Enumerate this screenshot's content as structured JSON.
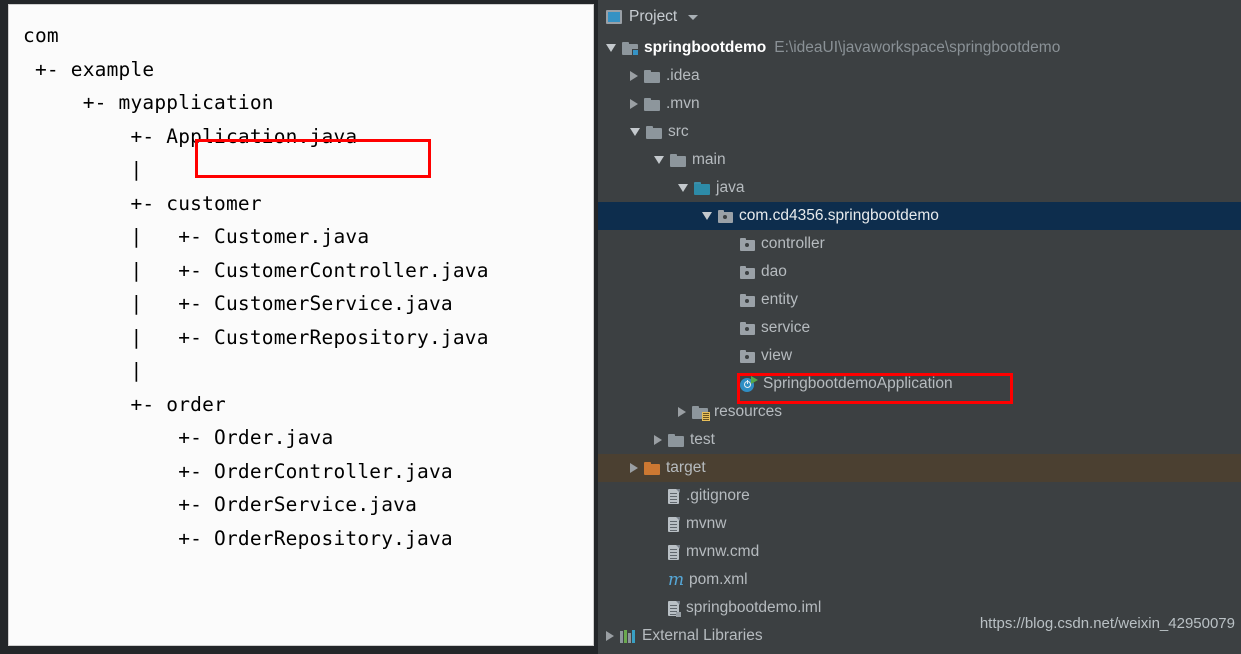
{
  "ascii_diagram": {
    "lines": [
      "com",
      " +- example",
      "     +- myapplication",
      "         +- Application.java",
      "         |",
      "         +- customer",
      "         |   +- Customer.java",
      "         |   +- CustomerController.java",
      "         |   +- CustomerService.java",
      "         |   +- CustomerRepository.java",
      "         |",
      "         +- order",
      "             +- Order.java",
      "             +- OrderController.java",
      "             +- OrderService.java",
      "             +- OrderRepository.java"
    ],
    "highlighted_entry": "Application.java"
  },
  "ide": {
    "toolbar": {
      "title": "Project",
      "project_icon": "project-view-icon",
      "dropdown_icon": "chevron-down-icon"
    },
    "highlighted_entry": "SpringbootdemoApplication",
    "watermark": "https://blog.csdn.net/weixin_42950079",
    "colors": {
      "panel_background": "#3c4042",
      "selection": "#0d2d4d",
      "excluded_row": "#4b4031",
      "highlight_box": "#ff0000",
      "source_folder": "#2d8ba8",
      "target_folder": "#cc7832"
    },
    "tree": [
      {
        "label": "springbootdemo",
        "path": "E:\\ideaUI\\javaworkspace\\springbootdemo",
        "indent": 0,
        "arrow": "down",
        "icon": "project-folder-icon",
        "style": "root"
      },
      {
        "label": ".idea",
        "path": "",
        "indent": 1,
        "arrow": "right",
        "icon": "folder-icon",
        "style": ""
      },
      {
        "label": ".mvn",
        "path": "",
        "indent": 1,
        "arrow": "right",
        "icon": "folder-icon",
        "style": ""
      },
      {
        "label": "src",
        "path": "",
        "indent": 1,
        "arrow": "down",
        "icon": "folder-icon",
        "style": ""
      },
      {
        "label": "main",
        "path": "",
        "indent": 2,
        "arrow": "down",
        "icon": "folder-icon",
        "style": ""
      },
      {
        "label": "java",
        "path": "",
        "indent": 3,
        "arrow": "down",
        "icon": "source-folder-icon",
        "style": ""
      },
      {
        "label": "com.cd4356.springbootdemo",
        "path": "",
        "indent": 4,
        "arrow": "down",
        "icon": "package-icon",
        "style": "selected"
      },
      {
        "label": "controller",
        "path": "",
        "indent": 5,
        "arrow": "none",
        "icon": "package-icon",
        "style": ""
      },
      {
        "label": "dao",
        "path": "",
        "indent": 5,
        "arrow": "none",
        "icon": "package-icon",
        "style": ""
      },
      {
        "label": "entity",
        "path": "",
        "indent": 5,
        "arrow": "none",
        "icon": "package-icon",
        "style": ""
      },
      {
        "label": "service",
        "path": "",
        "indent": 5,
        "arrow": "none",
        "icon": "package-icon",
        "style": ""
      },
      {
        "label": "view",
        "path": "",
        "indent": 5,
        "arrow": "none",
        "icon": "package-icon",
        "style": ""
      },
      {
        "label": "SpringbootdemoApplication",
        "path": "",
        "indent": 5,
        "arrow": "none",
        "icon": "spring-boot-run-icon",
        "style": ""
      },
      {
        "label": "resources",
        "path": "",
        "indent": 3,
        "arrow": "right",
        "icon": "resources-folder-icon",
        "style": ""
      },
      {
        "label": "test",
        "path": "",
        "indent": 2,
        "arrow": "right",
        "icon": "folder-icon",
        "style": ""
      },
      {
        "label": "target",
        "path": "",
        "indent": 1,
        "arrow": "right",
        "icon": "excluded-folder-icon",
        "style": "excluded"
      },
      {
        "label": ".gitignore",
        "path": "",
        "indent": 2,
        "arrow": "none",
        "icon": "file-icon",
        "style": ""
      },
      {
        "label": "mvnw",
        "path": "",
        "indent": 2,
        "arrow": "none",
        "icon": "file-icon",
        "style": ""
      },
      {
        "label": "mvnw.cmd",
        "path": "",
        "indent": 2,
        "arrow": "none",
        "icon": "file-icon",
        "style": ""
      },
      {
        "label": "pom.xml",
        "path": "",
        "indent": 2,
        "arrow": "none",
        "icon": "maven-icon",
        "style": ""
      },
      {
        "label": "springbootdemo.iml",
        "path": "",
        "indent": 2,
        "arrow": "none",
        "icon": "iml-file-icon",
        "style": ""
      },
      {
        "label": "External Libraries",
        "path": "",
        "indent": 0,
        "arrow": "right",
        "icon": "libraries-icon",
        "style": ""
      }
    ]
  }
}
